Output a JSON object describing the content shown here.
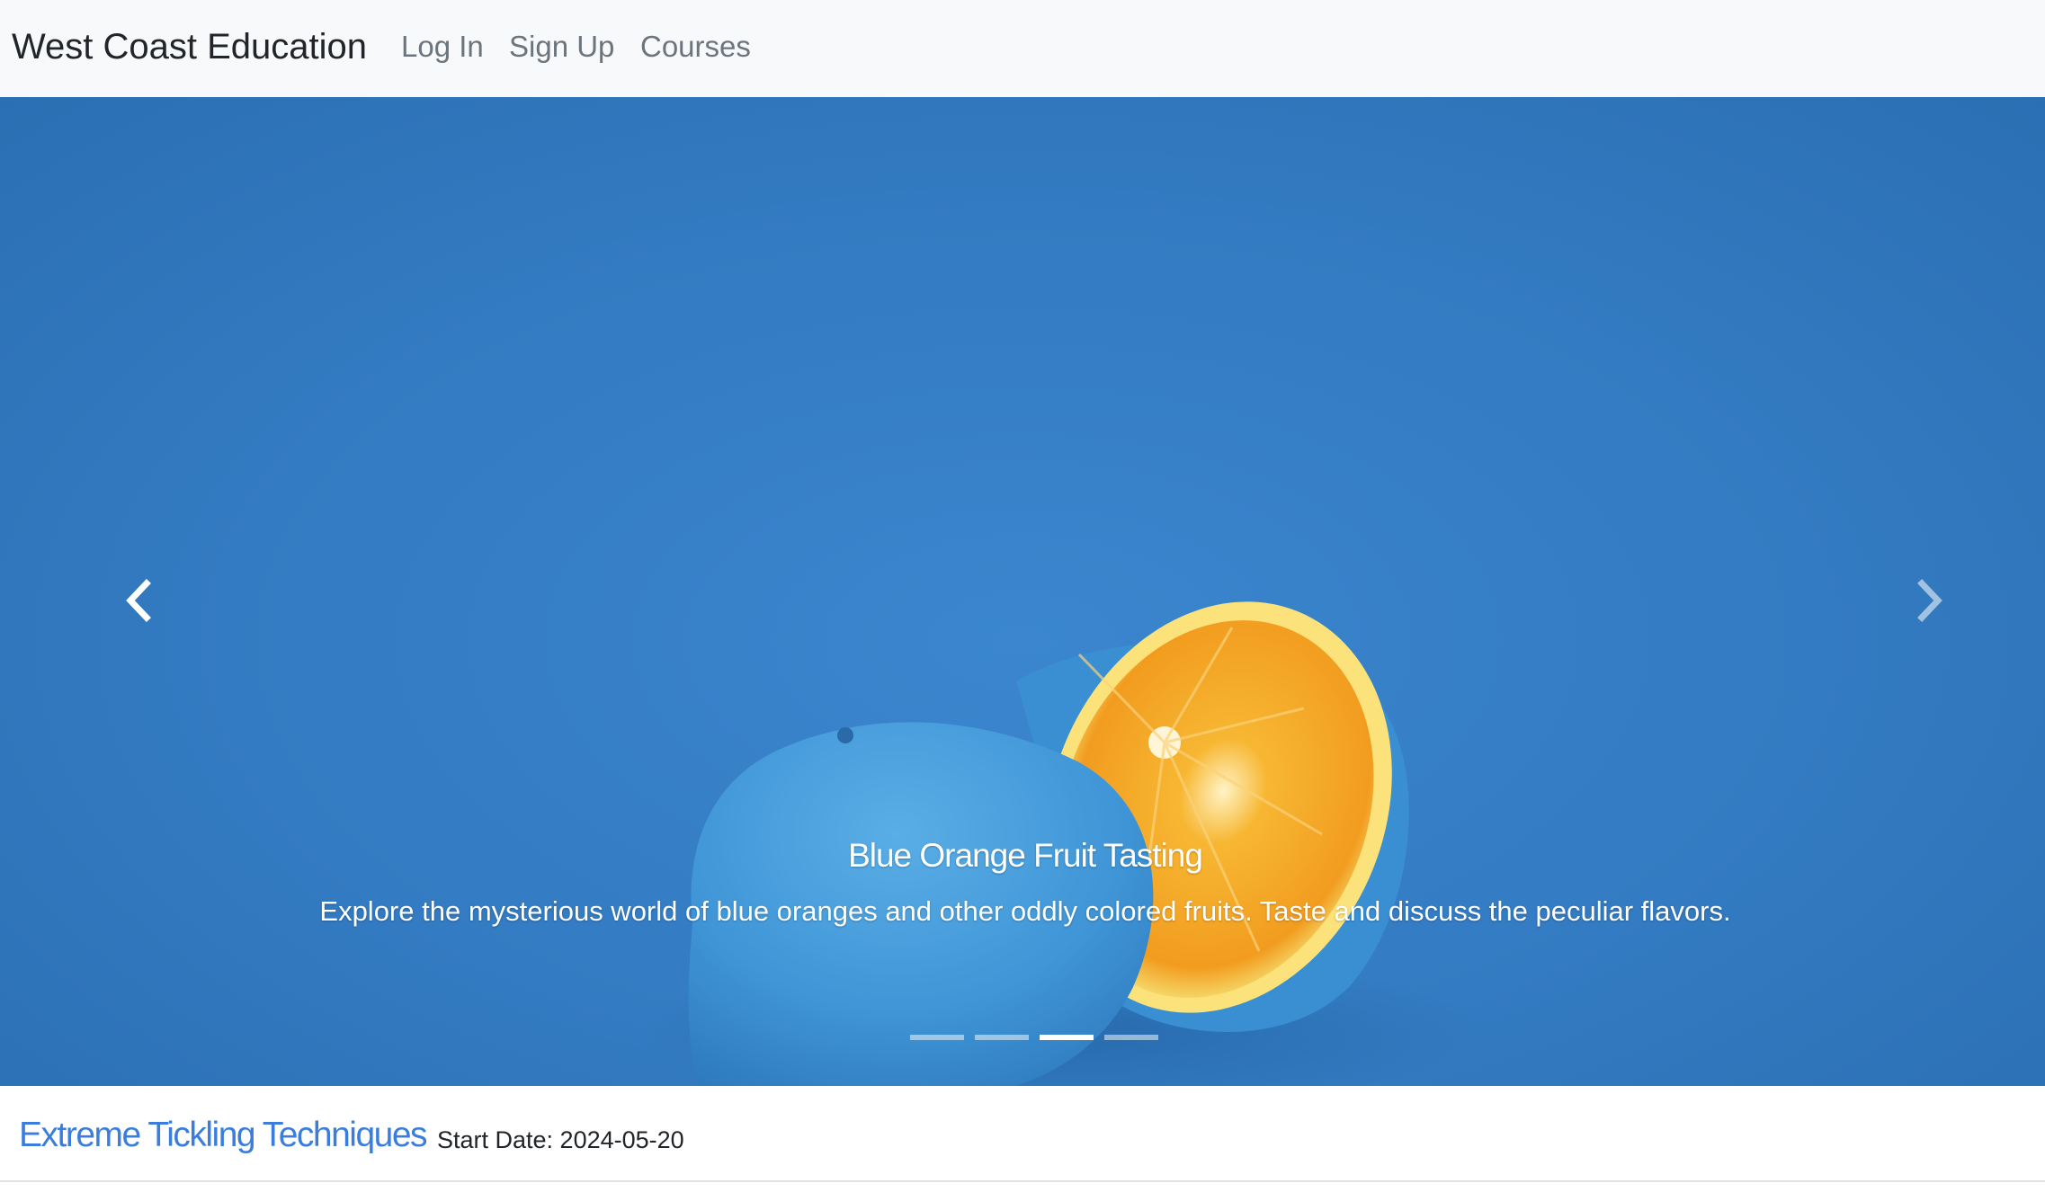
{
  "navbar": {
    "brand": "West Coast Education",
    "links": [
      "Log In",
      "Sign Up",
      "Courses"
    ]
  },
  "carousel": {
    "slide_title": "Blue Orange Fruit Tasting",
    "slide_description": "Explore the mysterious world of blue oranges and other oddly colored fruits. Taste and discuss the peculiar flavors.",
    "active_index": 2,
    "slide_count": 4,
    "prev_icon": "chevron-left-icon",
    "next_icon": "chevron-right-icon",
    "background_color": "#337bc2"
  },
  "courses": [
    {
      "title": "Extreme Tickling Techniques",
      "start_date": "Start Date: 2024-05-20"
    }
  ],
  "colors": {
    "navbar_bg": "#f8f9fa",
    "link_color": "#3b7ddd",
    "nav_link_color": "#6c757d"
  }
}
